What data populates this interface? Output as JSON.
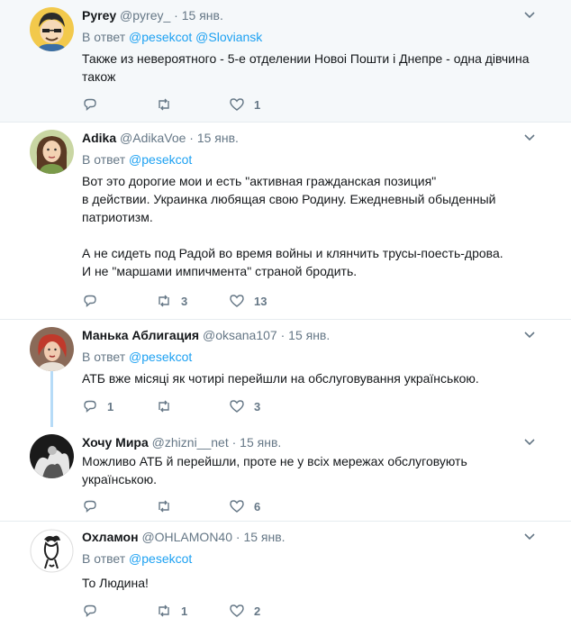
{
  "tweets": [
    {
      "name": "Pyrey",
      "handle": "@pyrey_",
      "dot": "·",
      "time": "15 янв.",
      "reply_prefix": "В ответ",
      "mentions": [
        "@pesekcot",
        "@Sloviansk"
      ],
      "text": "Также из невероятного - 5-е отделении Новоі Пошти і Днепре - одна дівчина також",
      "replies": "",
      "retweets": "",
      "likes": "1"
    },
    {
      "name": "Adika",
      "handle": "@AdikaVoe",
      "dot": "·",
      "time": "15 янв.",
      "reply_prefix": "В ответ",
      "mentions": [
        "@pesekcot"
      ],
      "text": "Вот это дорогие мои и есть \"активная гражданская позиция\"\nв действии. Украинка любящая свою Родину. Ежедневный обыденный патриотизм.\n\nА не сидеть под Радой во время войны и клянчить трусы-поесть-дрова.\nИ не \"маршами импичмента\" страной бродить.",
      "replies": "",
      "retweets": "3",
      "likes": "13"
    },
    {
      "name": "Манька Аблигация",
      "handle": "@oksana107",
      "dot": "·",
      "time": "15 янв.",
      "reply_prefix": "В ответ",
      "mentions": [
        "@pesekcot"
      ],
      "text": "АТБ вже місяці як чотирі перейшли на обслуговування українською.",
      "replies": "1",
      "retweets": "",
      "likes": "3"
    },
    {
      "name": "Хочу Мира",
      "handle": "@zhizni__net",
      "dot": "·",
      "time": "15 янв.",
      "reply_prefix": "",
      "mentions": [],
      "text": "Можливо АТБ й перейшли, проте не у всіх мережах обслуговують українською.",
      "replies": "",
      "retweets": "",
      "likes": "6"
    },
    {
      "name": "Охламон",
      "handle": "@OHLAMON40",
      "dot": "·",
      "time": "15 янв.",
      "reply_prefix": "В ответ",
      "mentions": [
        "@pesekcot"
      ],
      "text": "То Людина!",
      "replies": "",
      "retweets": "1",
      "likes": "2"
    }
  ],
  "icons": {
    "reply": "reply-icon",
    "retweet": "retweet-icon",
    "like": "heart-icon",
    "menu": "chevron-down-icon"
  },
  "colors": {
    "link": "#1da1f2",
    "muted": "#657786",
    "text": "#14171a",
    "highlight_bg": "#f5f8fa",
    "thread_line": "#b6dbf7"
  }
}
